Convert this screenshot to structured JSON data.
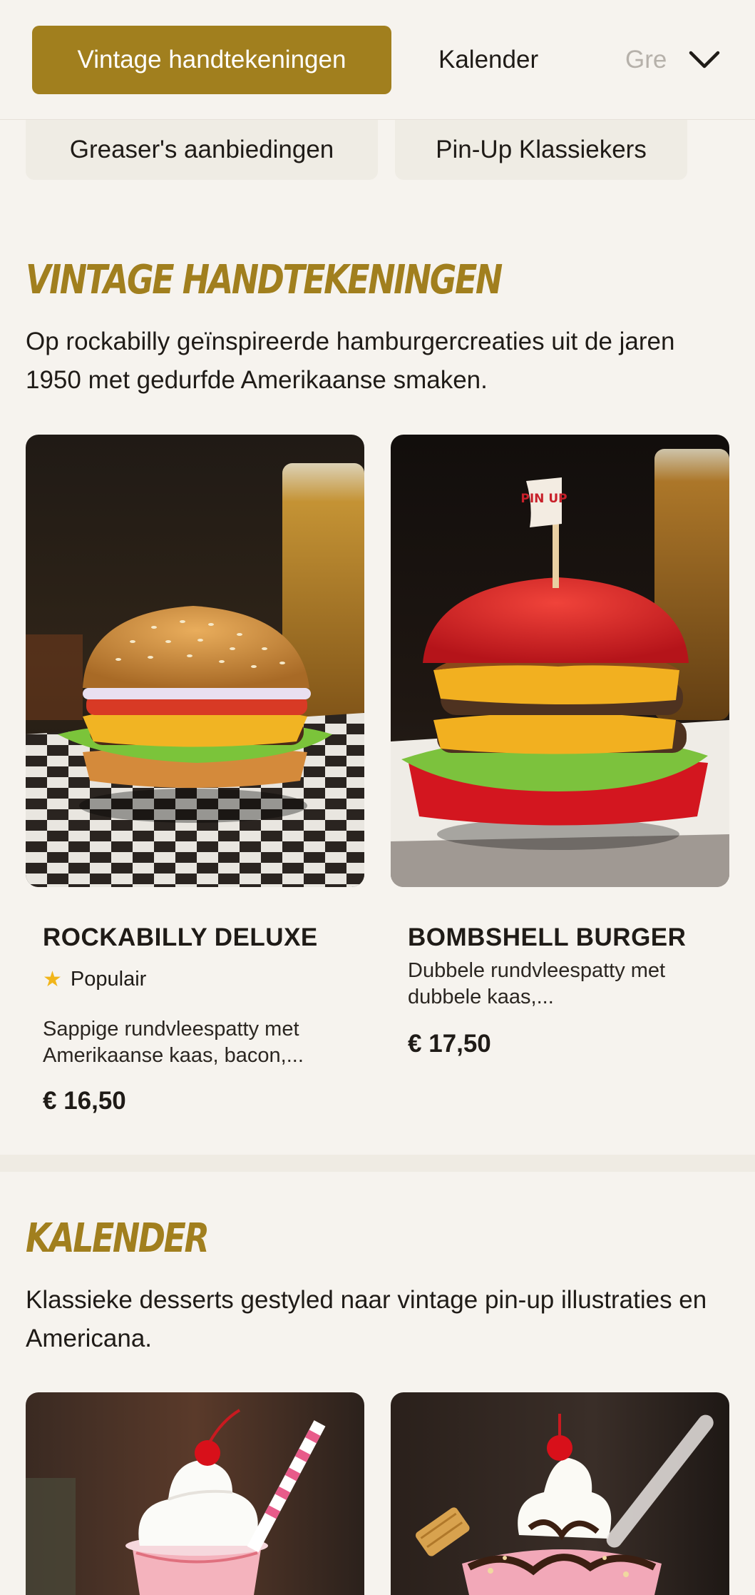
{
  "nav": {
    "tabs": [
      {
        "label": "Vintage handtekeningen"
      },
      {
        "label": "Kalender"
      },
      {
        "label": "Gre"
      }
    ]
  },
  "subnav": {
    "chips": [
      {
        "label": "Greaser's aanbiedingen"
      },
      {
        "label": "Pin-Up Klassiekers"
      }
    ]
  },
  "sections": [
    {
      "title": "Vintage handtekeningen",
      "description": "Op rockabilly geïnspireerde hamburgercreaties uit de jaren 1950 met gedurfde Amerikaanse smaken.",
      "items": [
        {
          "name": "Rockabilly Deluxe",
          "badge": "Populair",
          "description": "Sappige rundvleespatty met Amerikaanse kaas, bacon,...",
          "price": "€ 16,50"
        },
        {
          "name": "Bombshell Burger",
          "description": "Dubbele rundvleespatty met dubbele kaas,...",
          "price": "€ 17,50",
          "flag_text": "PIN UP"
        }
      ]
    },
    {
      "title": "Kalender",
      "description": "Klassieke desserts gestyled naar vintage pin-up illustraties en Americana."
    }
  ],
  "colors": {
    "accent": "#a17f1e",
    "background": "#f6f3ee",
    "star": "#f1b51a"
  },
  "icons": {
    "dropdown": "chevron-down-icon",
    "badge": "star-icon"
  }
}
